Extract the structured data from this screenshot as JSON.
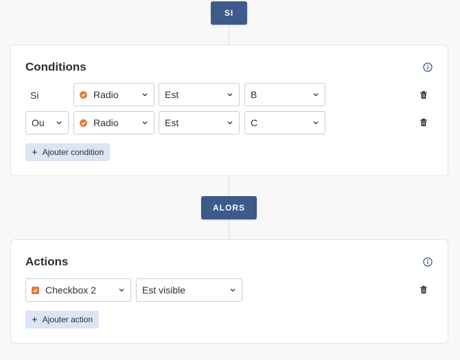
{
  "flow": {
    "si_label": "SI",
    "alors_label": "ALORS"
  },
  "conditions": {
    "title": "Conditions",
    "info_icon": "info-circle-icon",
    "rows": [
      {
        "prefix": "Si",
        "field": "Radio",
        "operator": "Est",
        "value": "B"
      },
      {
        "prefix": "Ou",
        "field": "Radio",
        "operator": "Est",
        "value": "C"
      }
    ],
    "add_label": "Ajouter condition"
  },
  "actions": {
    "title": "Actions",
    "info_icon": "info-circle-icon",
    "rows": [
      {
        "target": "Checkbox 2",
        "action": "Est visible"
      }
    ],
    "add_label": "Ajouter action"
  },
  "colors": {
    "pill": "#3d5a8a",
    "accent_orange": "#e07b39",
    "add_button_bg": "#dbe5f3"
  }
}
